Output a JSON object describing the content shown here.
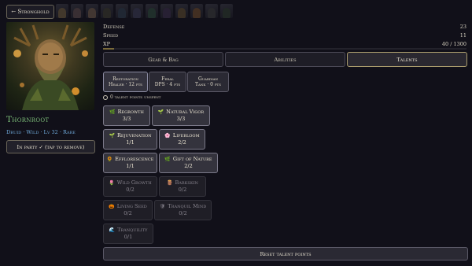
{
  "nav": {
    "back_label": "← Stronghold"
  },
  "roster": [
    {
      "icon": "hero-portrait-icon",
      "tint": "#6b5a3c"
    },
    {
      "icon": "hero-portrait-icon",
      "tint": "#5a4a4a"
    },
    {
      "icon": "hero-portrait-icon",
      "tint": "#6a5848"
    },
    {
      "icon": "hero-portrait-icon",
      "tint": "#3c3a2e"
    },
    {
      "icon": "hero-portrait-icon",
      "tint": "#2e3a4a"
    },
    {
      "icon": "hero-portrait-icon",
      "tint": "#3a3a52"
    },
    {
      "icon": "hero-portrait-icon",
      "tint": "#2e4a3a"
    },
    {
      "icon": "hero-portrait-icon",
      "tint": "#3a2e4a"
    },
    {
      "icon": "hero-portrait-icon",
      "tint": "#5a4a2e"
    },
    {
      "icon": "hero-portrait-icon",
      "tint": "#6a4a2a"
    },
    {
      "icon": "hero-portrait-icon",
      "tint": "#3a3a3a"
    },
    {
      "icon": "hero-portrait-icon",
      "tint": "#2e3a2e"
    }
  ],
  "hero": {
    "name": "Thornroot",
    "subtitle": "Druid · Wild · Lv 32 · Rare",
    "party_label": "In party ✓ (tap to remove)"
  },
  "stats": [
    {
      "label": "Defense",
      "value": "23"
    },
    {
      "label": "Speed",
      "value": "11"
    },
    {
      "label": "XP",
      "value": "40 / 1300"
    }
  ],
  "xp_fraction": 0.031,
  "tabs": [
    {
      "label": "Gear & Bag",
      "active": false
    },
    {
      "label": "Abilities",
      "active": false
    },
    {
      "label": "Talents",
      "active": true
    }
  ],
  "specs": [
    {
      "line1": "Restoration",
      "line2": "Healer · 12 pts",
      "selected": true
    },
    {
      "line1": "Feral",
      "line2": "DPS · 4 pts",
      "selected": false
    },
    {
      "line1": "Guardian",
      "line2": "Tank · 0 pts",
      "selected": false
    }
  ],
  "points_text": "0 talent points unspent",
  "talents": [
    {
      "name": "Regrowth",
      "rank": "3/3",
      "icon": "🌿",
      "state": "on"
    },
    {
      "name": "Natural Vigor",
      "rank": "3/3",
      "icon": "🌱",
      "state": "on"
    },
    {
      "name": "Rejuvenation",
      "rank": "1/1",
      "icon": "🌱",
      "state": "on"
    },
    {
      "name": "Lifebloom",
      "rank": "2/2",
      "icon": "🌸",
      "state": "on"
    },
    {
      "name": "Efflorescence",
      "rank": "1/1",
      "icon": "🌻",
      "state": "on"
    },
    {
      "name": "Gift of Nature",
      "rank": "2/2",
      "icon": "🌿",
      "state": "on"
    },
    {
      "name": "Wild Growth",
      "rank": "0/2",
      "icon": "🌷",
      "state": "off"
    },
    {
      "name": "Barkskin",
      "rank": "0/2",
      "icon": "🪵",
      "state": "off"
    },
    {
      "name": "Living Seed",
      "rank": "0/2",
      "icon": "🎃",
      "state": "off"
    },
    {
      "name": "Tranquil Mind",
      "rank": "0/2",
      "icon": "🛡",
      "state": "off"
    },
    {
      "name": "Tranquility",
      "rank": "0/1",
      "icon": "🌊",
      "state": "off"
    }
  ],
  "reset_label": "Reset talent points",
  "colors": {
    "accent": "#a89a6c",
    "name": "#7ec07a",
    "subtitle": "#6fa8d8"
  }
}
